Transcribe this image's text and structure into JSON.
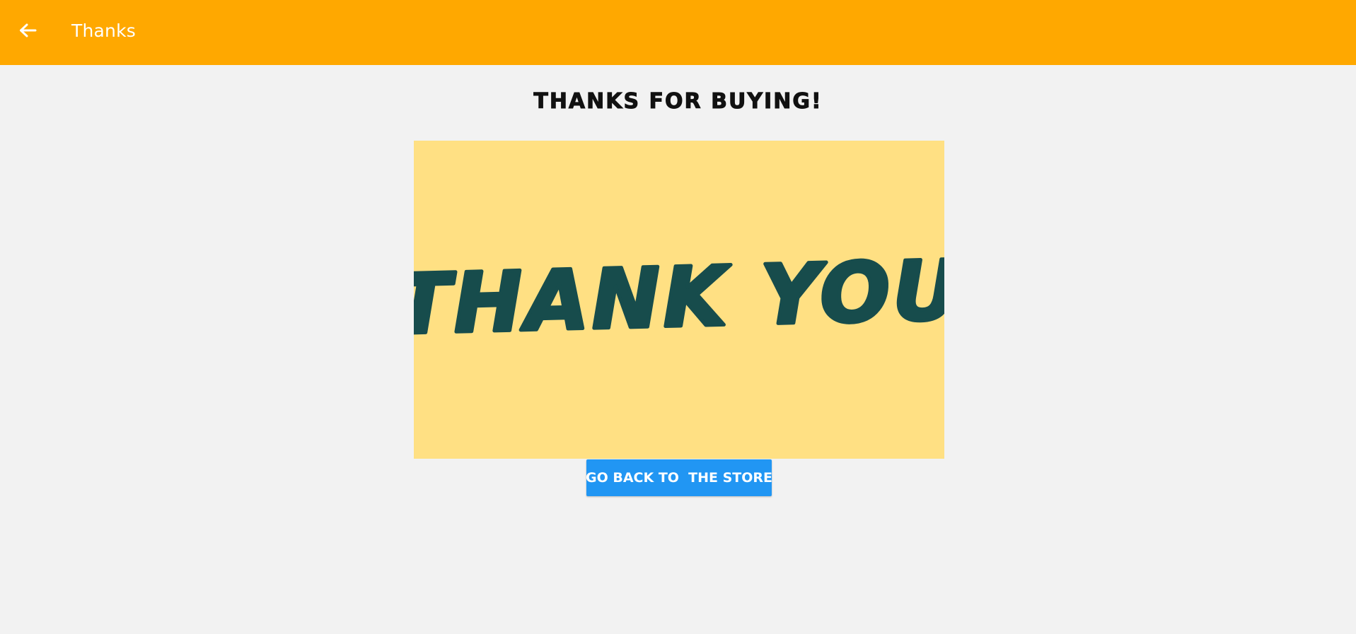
{
  "app_bar": {
    "back_icon": "arrow-left-icon",
    "title": "Thanks",
    "background": "#ffa800"
  },
  "main": {
    "heading": "THANKS FOR BUYING!",
    "image": {
      "text": "THANK YOU",
      "background": "#ffe083",
      "text_color": "#174c4c"
    },
    "store_button_label": "GO BACK TO  THE STORE",
    "store_button_color": "#2196f3"
  }
}
